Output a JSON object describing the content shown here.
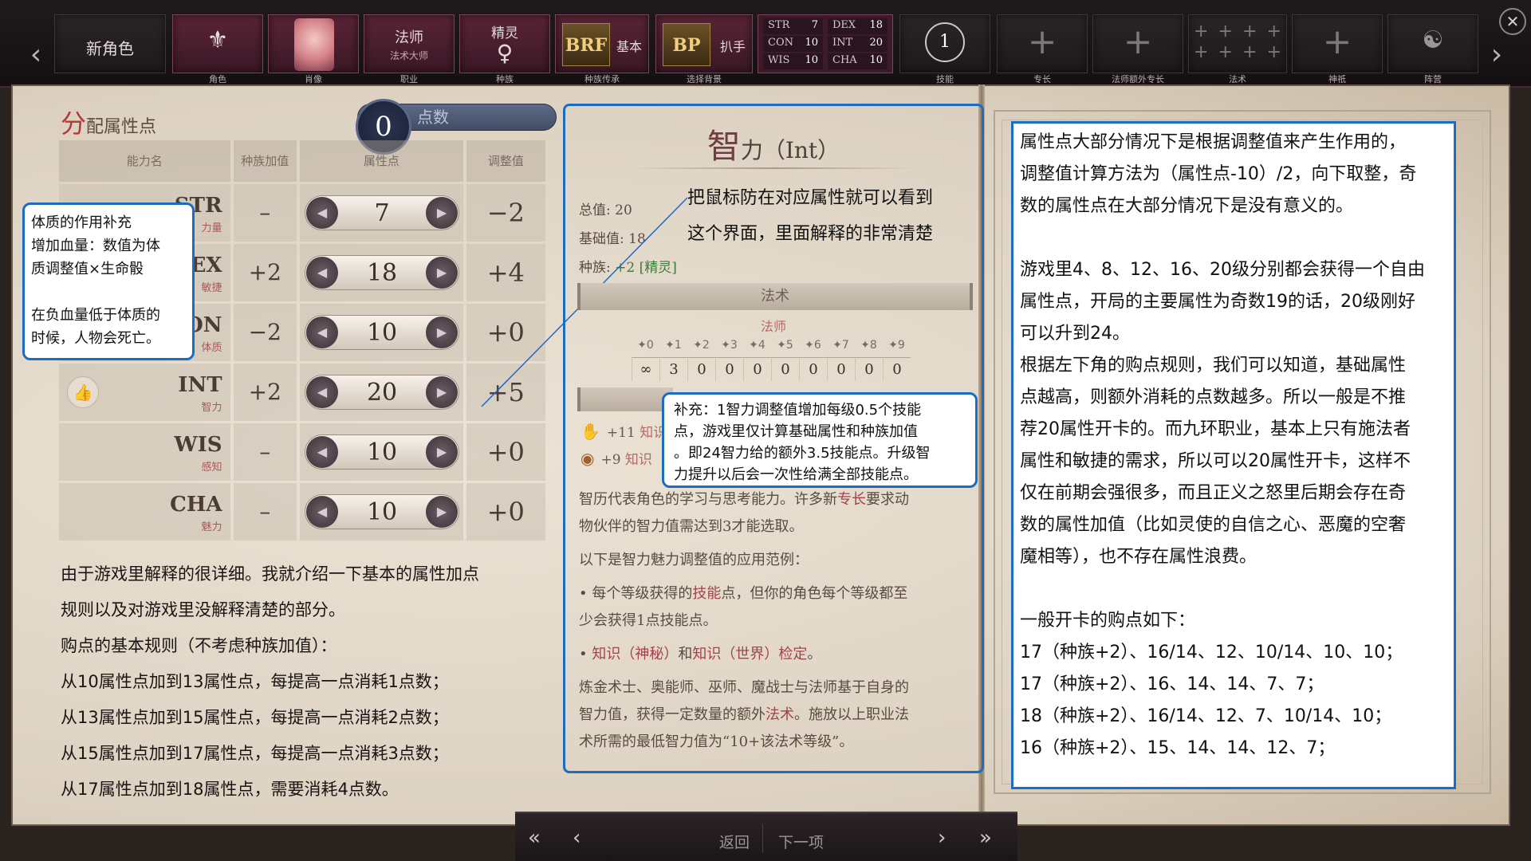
{
  "topbar": {
    "new_character": "新角色",
    "slots": [
      {
        "caption": "角色"
      },
      {
        "caption": "肖像"
      },
      {
        "title": "法师",
        "subtitle": "法术大师",
        "caption": "职业"
      },
      {
        "title": "精灵",
        "glyph": "♀",
        "caption": "种族"
      },
      {
        "icon_text": "BRF",
        "label": "基本",
        "caption": "种族传承"
      },
      {
        "icon_text": "BP",
        "label": "扒手",
        "caption": "选择背景"
      }
    ],
    "stats": [
      {
        "name": "STR",
        "value": "7"
      },
      {
        "name": "DEX",
        "value": "18"
      },
      {
        "name": "CON",
        "value": "10"
      },
      {
        "name": "INT",
        "value": "20"
      },
      {
        "name": "WIS",
        "value": "10"
      },
      {
        "name": "CHA",
        "value": "10"
      }
    ],
    "skills_count": "1",
    "skills_caption": "技能",
    "feat_caption": "专长",
    "wizard_feat_caption": "法师额外专长",
    "spells_caption": "法术",
    "deity_caption": "神祇",
    "alignment_caption": "阵营"
  },
  "left": {
    "title_first": "分",
    "title_rest": "配属性点",
    "points_value": "0",
    "points_label": "点数",
    "headers": [
      "能力名",
      "种族加值",
      "属性点",
      "调整值"
    ],
    "rows": [
      {
        "abbr": "STR",
        "cn": "力量",
        "bonus": "–",
        "value": "7",
        "mod": "−2"
      },
      {
        "abbr": "DEX",
        "cn": "敏捷",
        "bonus": "+2",
        "value": "18",
        "mod": "+4"
      },
      {
        "abbr": "CON",
        "cn": "体质",
        "bonus": "−2",
        "value": "10",
        "mod": "+0"
      },
      {
        "abbr": "INT",
        "cn": "智力",
        "bonus": "+2",
        "value": "20",
        "mod": "+5"
      },
      {
        "abbr": "WIS",
        "cn": "感知",
        "bonus": "–",
        "value": "10",
        "mod": "+0"
      },
      {
        "abbr": "CHA",
        "cn": "魅力",
        "bonus": "–",
        "value": "10",
        "mod": "+0"
      }
    ],
    "note": [
      "体质的作用补充",
      "增加血量：数值为体",
      "质调整值×生命骰",
      "",
      "在负血量低于体质的",
      "时候，人物会死亡。"
    ],
    "text": [
      "由于游戏里解释的很详细。我就介绍一下基本的属性加点",
      "规则以及对游戏里没解释清楚的部分。",
      "购点的基本规则（不考虑种族加值）：",
      "从10属性点加到13属性点，每提高一点消耗1点数；",
      "从13属性点加到15属性点，每提高一点消耗2点数；",
      "从15属性点加到17属性点，每提高一点消耗3点数；",
      "从17属性点加到18属性点，需要消耗4点数。"
    ]
  },
  "middle": {
    "title": "智",
    "title_rest": "力",
    "title_abbr": "（Int）",
    "total": "总值: 20",
    "base": "基础值: 18",
    "race_prefix": "种族: ",
    "race_value": "+2 [精灵]",
    "hover_note": [
      "把鼠标防在对应属性就可以看到",
      "这个界面，里面解释的非常清楚"
    ],
    "spell_header": "法术",
    "class_label": "法师",
    "spell_levels": [
      "0",
      "1",
      "2",
      "3",
      "4",
      "5",
      "6",
      "7",
      "8",
      "9"
    ],
    "spell_counts": [
      "∞",
      "3",
      "0",
      "0",
      "0",
      "0",
      "0",
      "0",
      "0",
      "0"
    ],
    "skill1_value": "+11",
    "skill1_label": "知识",
    "skill2_value": "+9",
    "skill2_label": "知识",
    "note": [
      "补充：1智力调整值增加每级0.5个技能",
      "点，游戏里仅计算基础属性和种族加值",
      "。即24智力给的额外3.5技能点。升级智",
      "力提升以后会一次性给满全部技能点。"
    ],
    "desc1a": "智历代表角色的学习与思考能力。许多新",
    "desc1_link": "专长",
    "desc1b": "要求动",
    "desc2": "物伙伴的智力值需达到3才能选取。",
    "desc3": "以下是智力魅力调整值的应用范例：",
    "desc4a": "• 每个等级获得的",
    "desc4_link": "技能",
    "desc4b": "点，但你的角色每个等级都至",
    "desc5": "少会获得1点技能点。",
    "desc6a": "• ",
    "desc6_link1": "知识（神秘）",
    "desc6_mid": "和",
    "desc6_link2": "知识（世界）检定",
    "desc6_end": "。",
    "desc7": "炼金术士、奥能师、巫师、魔战士与法师基于自身的",
    "desc8a": "智力值，获得一定数量的额外",
    "desc8_link": "法术",
    "desc8b": "。施放以上职业法",
    "desc9": "术所需的最低智力值为“10+该法术等级”。"
  },
  "right": {
    "lines": [
      "属性点大部分情况下是根据调整值来产生作用的，",
      "调整值计算方法为（属性点-10）/2，向下取整，奇",
      "数的属性点在大部分情况下是没有意义的。",
      "",
      "游戏里4、8、12、16、20级分别都会获得一个自由",
      "属性点，开局的主要属性为奇数19的话，20级刚好",
      "可以升到24。",
      "根据左下角的购点规则，我们可以知道，基础属性",
      "点越高，则额外消耗的点数越多。所以一般是不推",
      "荐20属性开卡的。而九环职业，基本上只有施法者",
      "属性和敏捷的需求，所以可以20属性开卡，这样不",
      "仅在前期会强很多，而且正义之怒里后期会存在奇",
      "数的属性加值（比如灵使的自信之心、恶魔的空奢",
      "魔相等），也不存在属性浪费。",
      "",
      "一般开卡的购点如下：",
      "17（种族+2）、16/14、12、10/14、10、10；",
      "17（种族+2）、16、14、14、7、7；",
      "18（种族+2）、16/14、12、7、10/14、10；",
      "16（种族+2）、15、14、14、12、7；"
    ]
  },
  "bottom": {
    "back": "返回",
    "next": "下一项"
  },
  "colors": {
    "annotation_border": "#1c6cc0",
    "accent_red": "#b43a3a",
    "slot_bg": "#5a2436"
  }
}
